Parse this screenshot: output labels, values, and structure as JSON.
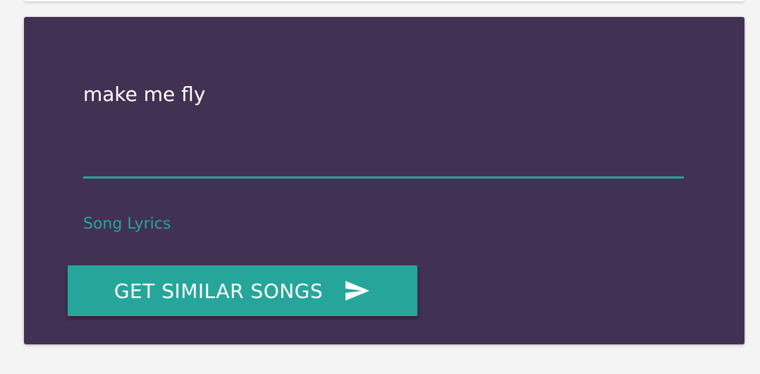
{
  "search_form": {
    "lyrics_input": {
      "value": "make me fly",
      "label": "Song Lyrics"
    },
    "submit_button": {
      "label": "GET SIMILAR SONGS",
      "icon": "send-icon"
    }
  },
  "colors": {
    "card_background": "#413152",
    "accent": "#26a69a",
    "page_background": "#f4f4f4",
    "text": "#ffffff"
  }
}
